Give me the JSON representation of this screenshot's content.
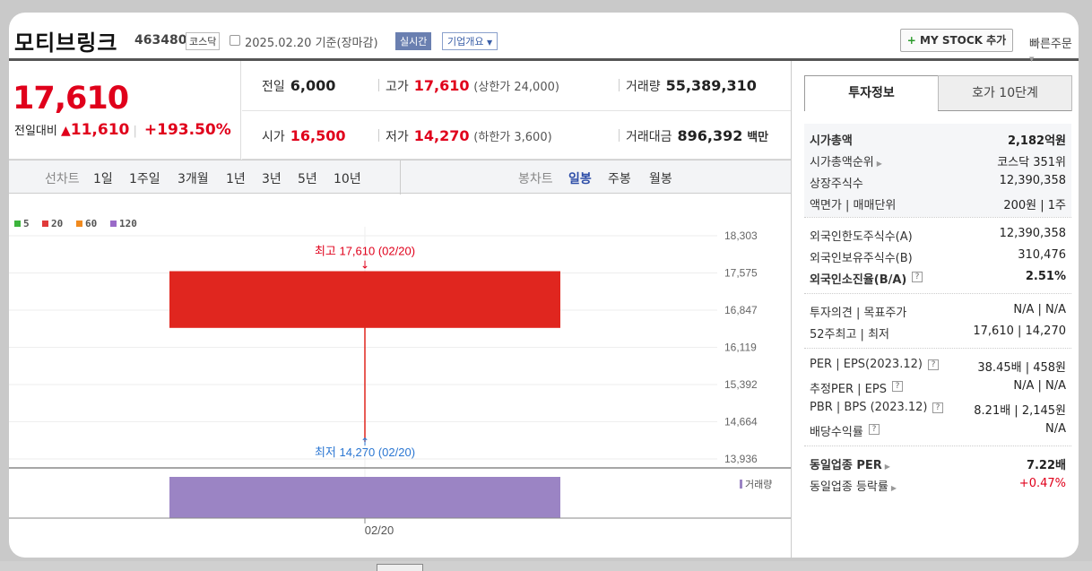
{
  "header": {
    "company": "모티브링크",
    "code": "463480",
    "market": "코스닥",
    "date": "2025.02.20",
    "basis": "기준(장마감)",
    "realtime": "실시간",
    "corp_info": "기업개요",
    "my_stock": "MY STOCK 추가",
    "quick_order": "빠른주문"
  },
  "price": {
    "current": "17,610",
    "change_label": "전일대비",
    "change": "11,610",
    "change_pct": "+193.50%"
  },
  "stats": {
    "prev_close_label": "전일",
    "prev_close": "6,000",
    "high_label": "고가",
    "high": "17,610",
    "upper_limit": "(상한가 24,000)",
    "volume_label": "거래량",
    "volume": "55,389,310",
    "open_label": "시가",
    "open": "16,500",
    "low_label": "저가",
    "low": "14,270",
    "lower_limit": "(하한가 3,600)",
    "amount_label": "거래대금",
    "amount": "896,392",
    "amount_unit": "백만"
  },
  "chart_tabs": {
    "line_label": "선차트",
    "line_items": [
      "1일",
      "1주일",
      "3개월",
      "1년",
      "3년",
      "5년",
      "10년"
    ],
    "candle_label": "봉차트",
    "candle_items": [
      "일봉",
      "주봉",
      "월봉"
    ],
    "candle_selected": "일봉"
  },
  "chart_data": {
    "type": "candlestick",
    "legend": [
      {
        "name": "5",
        "color": "#3cb43c"
      },
      {
        "name": "20",
        "color": "#e03a3a"
      },
      {
        "name": "60",
        "color": "#f08a1e"
      },
      {
        "name": "120",
        "color": "#9a6ac8"
      }
    ],
    "y_ticks": [
      "18,303",
      "17,575",
      "16,847",
      "16,119",
      "15,392",
      "14,664",
      "13,936"
    ],
    "ylim": [
      13936,
      18303
    ],
    "x_ticks": [
      "02/20"
    ],
    "candles": [
      {
        "date": "02/20",
        "open": 16500,
        "high": 17610,
        "low": 14270,
        "close": 17610,
        "volume": 55389310
      }
    ],
    "high_annotation": "최고 17,610 (02/20)",
    "low_annotation": "최저 14,270 (02/20)",
    "volume_label": "거래량",
    "candle_color": "#e0261f",
    "volume_color": "#9b84c4"
  },
  "right_tabs": {
    "tab1": "투자정보",
    "tab2": "호가 10단계"
  },
  "invest": {
    "g1": [
      {
        "k": "시가총액",
        "v": "2,182억원"
      },
      {
        "k": "시가총액순위",
        "v": "코스닥 351위"
      },
      {
        "k": "상장주식수",
        "v": "12,390,358"
      },
      {
        "k": "액면가 | 매매단위",
        "v": "200원 | 1주"
      }
    ],
    "g2": [
      {
        "k": "외국인한도주식수(A)",
        "v": "12,390,358"
      },
      {
        "k": "외국인보유주식수(B)",
        "v": "310,476"
      },
      {
        "k": "외국인소진율(B/A)",
        "v": "2.51%"
      }
    ],
    "g3": [
      {
        "k": "투자의견 | 목표주가",
        "v": "N/A | N/A"
      },
      {
        "k": "52주최고 | 최저",
        "v": "17,610 | 14,270"
      }
    ],
    "g4": [
      {
        "k": "PER | EPS(2023.12)",
        "v": "38.45배 | 458원"
      },
      {
        "k": "추정PER | EPS",
        "v": "N/A | N/A"
      },
      {
        "k": "PBR | BPS (2023.12)",
        "v": "8.21배 | 2,145원"
      },
      {
        "k": "배당수익률",
        "v": "N/A"
      }
    ],
    "g5": [
      {
        "k": "동일업종 PER",
        "v": "7.22배"
      },
      {
        "k": "동일업종 등락률",
        "v": "+0.47%"
      }
    ]
  }
}
